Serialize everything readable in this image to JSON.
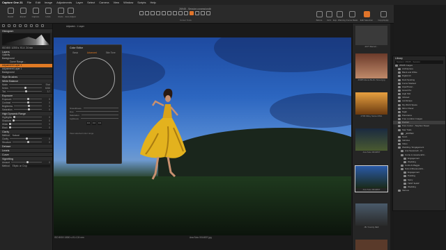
{
  "menubar": {
    "app": "Capture One 21",
    "items": [
      "File",
      "Edit",
      "Image",
      "Adjustments",
      "Layer",
      "Select",
      "Camera",
      "View",
      "Window",
      "Scripts",
      "Help"
    ]
  },
  "window": {
    "title": "26945 - Session.cosessiondb"
  },
  "toolbar": {
    "left": [
      "Import",
      "Export",
      "Capture",
      "Undo",
      "Redo"
    ],
    "auto_adjust": "Auto Adjust",
    "right": [
      "Before",
      "Grid",
      "Exp. Warning",
      "Focus Mask",
      "Edit Selection",
      "Copy/Apply"
    ],
    "cursor_tools": "Cursor Tools"
  },
  "left_panel": {
    "histogram_label": "Histogram",
    "exif": [
      "ISO 800",
      "1/200 s",
      "f/1.4",
      "24 mm"
    ],
    "layers_label": "Layers",
    "layer_items": [
      "Opacity",
      "Background",
      "Curve Range ...",
      "Adjustment Layer 1",
      "Adjustment Layer 1",
      "Background"
    ],
    "style_brushes": "Style Brushes",
    "white_balance": "White Balance",
    "wb_rows": [
      {
        "l": "Mode",
        "v": "Shot"
      },
      {
        "l": "Kelvin",
        "v": "6266"
      },
      {
        "l": "Tint",
        "v": "3.7"
      }
    ],
    "exposure": "Exposure",
    "exp_rows": [
      {
        "l": "Exposure",
        "v": "0"
      },
      {
        "l": "Contrast",
        "v": "0"
      },
      {
        "l": "Brightness",
        "v": "0"
      },
      {
        "l": "Saturation",
        "v": "0"
      }
    ],
    "hdr": "High Dynamic Range",
    "hdr_rows": [
      {
        "l": "Highlights",
        "v": "0"
      },
      {
        "l": "Shadows",
        "v": "0"
      },
      {
        "l": "White",
        "v": "0"
      },
      {
        "l": "Black",
        "v": "0"
      }
    ],
    "clarity": "Clarity",
    "clarity_rows": [
      {
        "l": "Method",
        "v": "Natural"
      },
      {
        "l": "Clarity",
        "v": "0"
      },
      {
        "l": "Structure",
        "v": "0"
      }
    ],
    "others": [
      "Dehaze",
      "Levels",
      "Curve",
      "Vignetting"
    ],
    "vig_rows": [
      {
        "l": "Amount",
        "v": "0"
      },
      {
        "l": "Method",
        "v": "Elliptic on Crop"
      }
    ]
  },
  "viewer": {
    "header": "Adjusted - 1 Layer",
    "status_left": "ISO 8000   1/800 s   f/1.4   24 mm",
    "status_mid": "Ana Soto 0014837.jpg"
  },
  "color_editor": {
    "title": "Color Editor",
    "tabs": [
      "Basic",
      "Advanced",
      "Skin Tone"
    ],
    "rows": [
      "Smoothness",
      "Hue",
      "Saturation",
      "Lightness"
    ],
    "values": [
      "0.0",
      "0.0",
      "0.0"
    ],
    "hint": "View selected color range"
  },
  "browser": {
    "thumbs": [
      "2977 Barrett...",
      "26965 Elena Berlin Street.jpg",
      "2796 Miley Swiss.DNG",
      "Ana Soto 0014837",
      "Ana Soto 0014837",
      "JB / Family.NEF",
      ""
    ]
  },
  "library": {
    "title": "Library",
    "search": "Session: 26945 - Session",
    "items": [
      "26945 Images",
      "Architecture",
      "Black and White",
      "Digital Art",
      "Dark Spotting",
      "Focus Stacked",
      "HiperPanel...",
      "Grand Pix",
      "High ISO",
      "Infrared",
      "Landscape",
      "My World Space",
      "Mirror Panel",
      "Night",
      "Panorama",
      "Free Location Images",
      "Portrait",
      "Pure Colour - Stephen Sweet",
      "Star Trails",
      "_EDITED",
      "Torch",
      "Vehicles",
      "Video",
      "Wedding / Engagement",
      "Ana Savannah - R...",
      "Currie & Jessica ENI...",
      "Engagement",
      "Wedding",
      "Curtis & Maggie",
      "Nick & Brianna ENI...",
      "Engagement",
      "Pudding",
      "Spicy",
      "TEST SHAP",
      "Wedding",
      "Various"
    ]
  }
}
